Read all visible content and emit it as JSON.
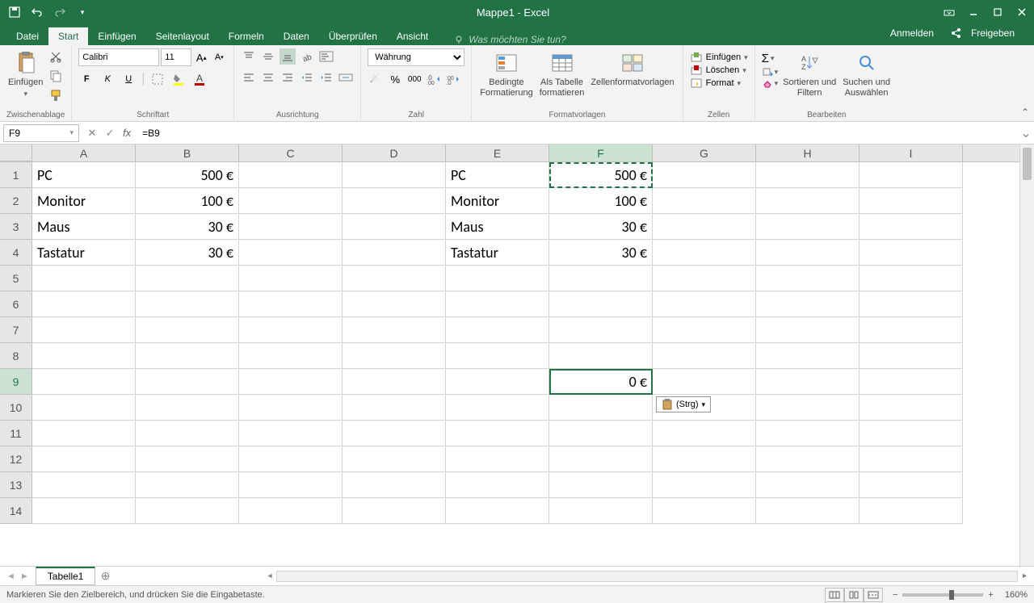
{
  "app": {
    "title": "Mappe1 - Excel"
  },
  "tabs": {
    "file": "Datei",
    "home": "Start",
    "insert": "Einfügen",
    "layout": "Seitenlayout",
    "formulas": "Formeln",
    "data": "Daten",
    "review": "Überprüfen",
    "view": "Ansicht",
    "tellme": "Was möchten Sie tun?",
    "signin": "Anmelden",
    "share": "Freigeben"
  },
  "ribbon": {
    "clipboard": {
      "paste": "Einfügen",
      "label": "Zwischenablage"
    },
    "font": {
      "name": "Calibri",
      "size": "11",
      "label": "Schriftart"
    },
    "align": {
      "label": "Ausrichtung"
    },
    "number": {
      "format": "Währung",
      "label": "Zahl"
    },
    "styles": {
      "cond": "Bedingte\nFormatierung",
      "table": "Als Tabelle\nformatieren",
      "cellstyles": "Zellenformatvorlagen",
      "label": "Formatvorlagen"
    },
    "cells": {
      "insert": "Einfügen",
      "delete": "Löschen",
      "format": "Format",
      "label": "Zellen"
    },
    "editing": {
      "sort": "Sortieren und\nFiltern",
      "find": "Suchen und\nAuswählen",
      "label": "Bearbeiten"
    }
  },
  "formula": {
    "namebox": "F9",
    "content": "=B9"
  },
  "cols": [
    "A",
    "B",
    "C",
    "D",
    "E",
    "F",
    "G",
    "H",
    "I"
  ],
  "rows": [
    "1",
    "2",
    "3",
    "4",
    "5",
    "6",
    "7",
    "8",
    "9",
    "10",
    "11",
    "12",
    "13",
    "14"
  ],
  "cells": {
    "A1": "PC",
    "B1": "500 €",
    "E1": "PC",
    "F1": "500 €",
    "A2": "Monitor",
    "B2": "100 €",
    "E2": "Monitor",
    "F2": "100 €",
    "A3": "Maus",
    "B3": "30 €",
    "E3": "Maus",
    "F3": "30 €",
    "A4": "Tastatur",
    "B4": "30 €",
    "E4": "Tastatur",
    "F4": "30 €",
    "F9": "0 €"
  },
  "pasteOptions": "(Strg)",
  "sheet": {
    "name": "Tabelle1"
  },
  "status": {
    "text": "Markieren Sie den Zielbereich, und drücken Sie die Eingabetaste.",
    "zoom": "160%"
  },
  "selectedCell": "F9",
  "marchingCell": "F1",
  "selectedCol": "F",
  "selectedRow": "9"
}
